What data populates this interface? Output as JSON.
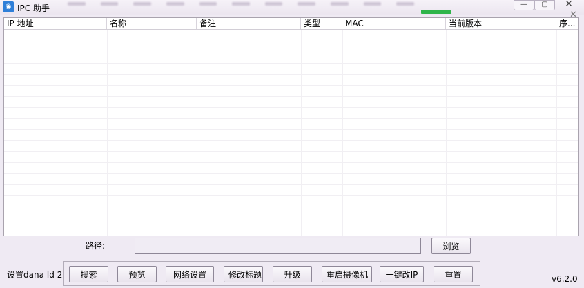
{
  "window": {
    "title": "IPC 助手",
    "icon": "camera-icon",
    "controls": [
      "minimize-icon",
      "maximize-icon",
      "close-icon"
    ]
  },
  "table": {
    "columns": [
      "IP 地址",
      "名称",
      "备注",
      "类型",
      "MAC",
      "当前版本",
      "序..."
    ],
    "rows": []
  },
  "path": {
    "label": "路径:",
    "value": "",
    "browse_label": "浏览"
  },
  "footer": {
    "set_id_label": "设置dana Id 2",
    "buttons": [
      "搜索",
      "预览",
      "网络设置",
      "修改标题",
      "升级",
      "重启摄像机",
      "一键改IP",
      "重置"
    ],
    "version": "v6.2.0"
  },
  "colors": {
    "accent_green": "#2fb54a",
    "icon_blue": "#2f7fd8"
  }
}
